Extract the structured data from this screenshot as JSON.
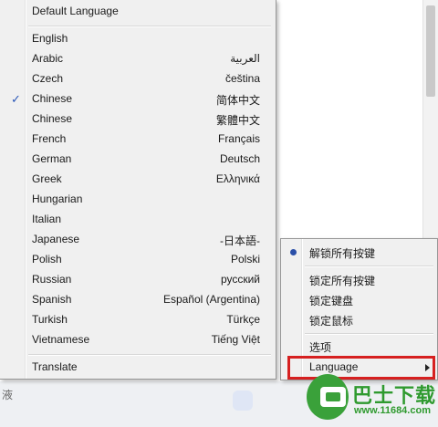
{
  "language_menu": {
    "default_label": "Default Language",
    "items": [
      {
        "label": "English",
        "native": "",
        "checked": false
      },
      {
        "label": "Arabic",
        "native": "العربية",
        "checked": false
      },
      {
        "label": "Czech",
        "native": "čeština",
        "checked": false
      },
      {
        "label": "Chinese",
        "native": "简体中文",
        "checked": true
      },
      {
        "label": "Chinese",
        "native": "繁體中文",
        "checked": false
      },
      {
        "label": "French",
        "native": "Français",
        "checked": false
      },
      {
        "label": "German",
        "native": "Deutsch",
        "checked": false
      },
      {
        "label": "Greek",
        "native": "Ελληνικά",
        "checked": false
      },
      {
        "label": "Hungarian",
        "native": "",
        "checked": false
      },
      {
        "label": "Italian",
        "native": "",
        "checked": false
      },
      {
        "label": "Japanese",
        "native": "-日本語-",
        "checked": false
      },
      {
        "label": "Polish",
        "native": "Polski",
        "checked": false
      },
      {
        "label": "Russian",
        "native": "русский",
        "checked": false
      },
      {
        "label": "Spanish",
        "native": "Español (Argentina)",
        "checked": false
      },
      {
        "label": "Turkish",
        "native": "Türkçe",
        "checked": false
      },
      {
        "label": "Vietnamese",
        "native": "Tiếng Việt",
        "checked": false
      }
    ],
    "translate_label": "Translate",
    "check_glyph": "✓"
  },
  "context_menu": {
    "items": [
      {
        "label": "解锁所有按键",
        "selected": true
      },
      {
        "label": "锁定所有按键"
      },
      {
        "label": "锁定键盘"
      },
      {
        "label": "锁定鼠标"
      },
      {
        "label": "选项"
      },
      {
        "label": "Language",
        "submenu": true
      }
    ]
  },
  "background": {
    "bottom_text": "液"
  },
  "watermark": {
    "title": "巴士下载",
    "url": "www.11684.com"
  },
  "colors": {
    "menu_bg": "#f0f0f0",
    "accent": "#2a57b8",
    "highlight_border": "#d62020",
    "watermark_green": "#2f9a2f"
  }
}
